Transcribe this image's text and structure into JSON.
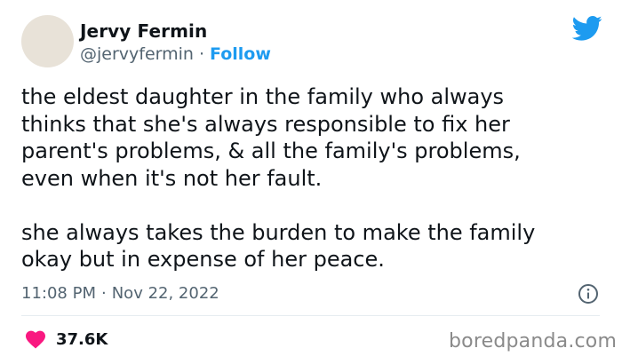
{
  "tweet": {
    "author_name": "Jervy Fermin",
    "handle": "@jervyfermin",
    "separator": "·",
    "follow_label": "Follow",
    "text": "the eldest daughter in the family who always\nthinks that she's always responsible to fix her\nparent's problems, & all the family's problems,\neven when it's not her fault.\n\nshe always takes the burden to make the family\nokay but in expense of her peace.",
    "time": "11:08 PM",
    "date": "Nov 22, 2022",
    "likes": "37.6K"
  },
  "icons": {
    "brand": "twitter-bird-icon",
    "info": "info-icon",
    "like": "heart-icon"
  },
  "colors": {
    "accent": "#1d9bf0",
    "like": "#f91880",
    "text": "#0f1419",
    "muted": "#536471"
  },
  "watermark": "boredpanda.com"
}
